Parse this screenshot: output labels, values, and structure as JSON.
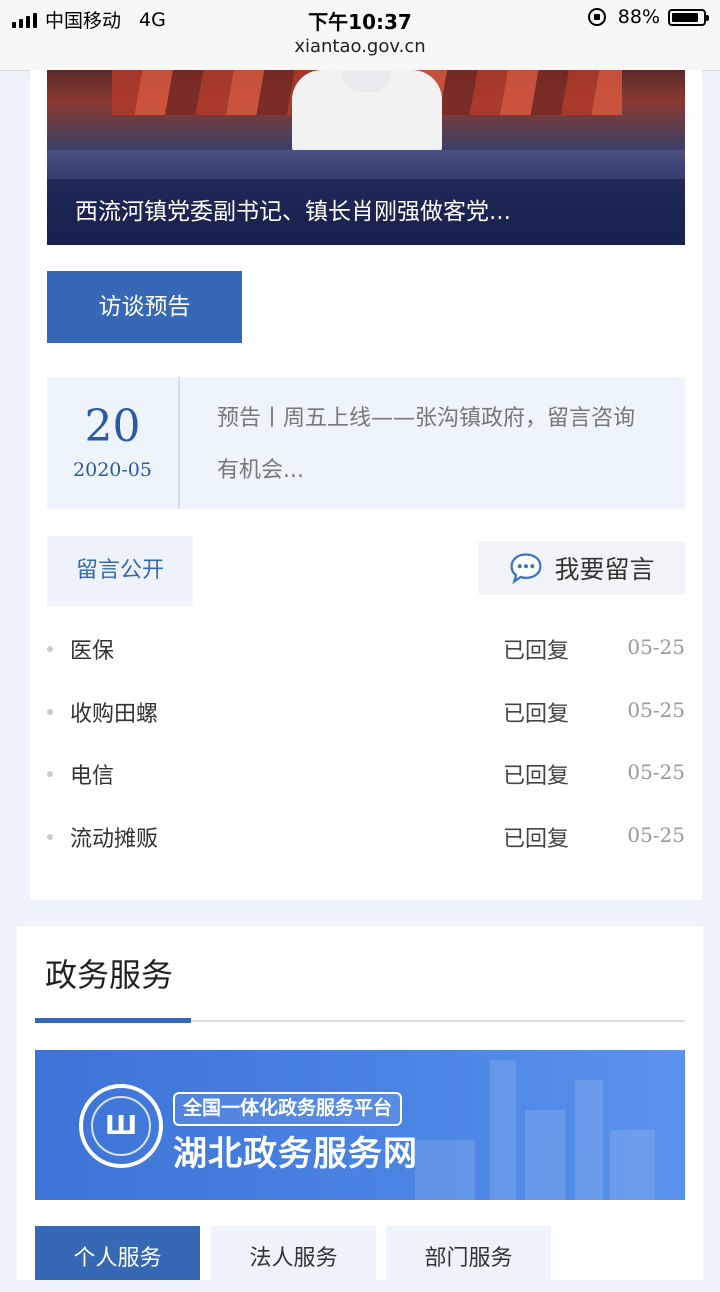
{
  "status_bar": {
    "carrier": "中国移动",
    "network": "4G",
    "time": "下午10:37",
    "battery": "88%",
    "battery_level": 0.88,
    "url": "xiantao.gov.cn"
  },
  "hero": {
    "caption": "西流河镇党委副书记、镇长肖刚强做客党..."
  },
  "interview_button": "访谈预告",
  "notice": {
    "day": "20",
    "year_month": "2020-05",
    "text": "预告丨周五上线——张沟镇政府，留言咨询有机会..."
  },
  "messages": {
    "tab_label": "留言公开",
    "write_label": "我要留言",
    "items": [
      {
        "title": "医保",
        "status": "已回复",
        "date": "05-25"
      },
      {
        "title": "收购田螺",
        "status": "已回复",
        "date": "05-25"
      },
      {
        "title": "电信",
        "status": "已回复",
        "date": "05-25"
      },
      {
        "title": "流动摊贩",
        "status": "已回复",
        "date": "05-25"
      }
    ]
  },
  "gov_service": {
    "title": "政务服务",
    "banner": {
      "subtitle": "全国一体化政务服务平台",
      "title": "湖北政务服务网"
    },
    "tabs": [
      {
        "label": "个人服务",
        "active": true
      },
      {
        "label": "法人服务",
        "active": false
      },
      {
        "label": "部门服务",
        "active": false
      }
    ]
  },
  "colors": {
    "accent": "#3668b5",
    "page_bg": "#eef3fb"
  }
}
